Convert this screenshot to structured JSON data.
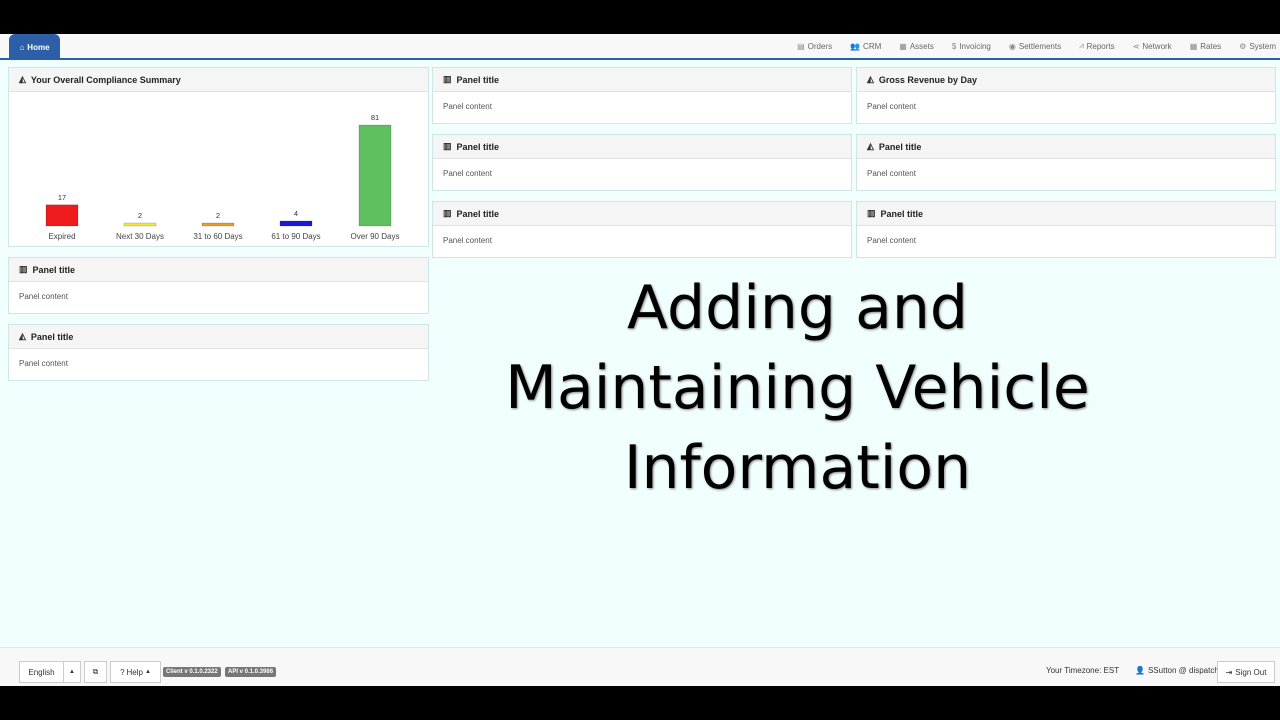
{
  "nav": {
    "home": "Home",
    "items": [
      {
        "label": "Orders",
        "icon": "document-icon",
        "glyph": "▤"
      },
      {
        "label": "CRM",
        "icon": "users-icon",
        "glyph": "👥"
      },
      {
        "label": "Assets",
        "icon": "truck-icon",
        "glyph": "▦"
      },
      {
        "label": "Invoicing",
        "icon": "dollar-icon",
        "glyph": "$"
      },
      {
        "label": "Settlements",
        "icon": "eye-icon",
        "glyph": "◉"
      },
      {
        "label": "Reports",
        "icon": "line-chart-icon",
        "glyph": "⩘"
      },
      {
        "label": "Network",
        "icon": "share-icon",
        "glyph": "⋖"
      },
      {
        "label": "Rates",
        "icon": "table-icon",
        "glyph": "▦"
      },
      {
        "label": "System",
        "icon": "gear-icon",
        "glyph": "⚙"
      }
    ]
  },
  "panels": {
    "compliance_title": "Your Overall Compliance Summary",
    "gross_revenue_title": "Gross Revenue by Day",
    "generic_title": "Panel title",
    "generic_content": "Panel content"
  },
  "chart_data": {
    "type": "bar",
    "categories": [
      "Expired",
      "Next 30 Days",
      "31 to 60 Days",
      "61 to 90 Days",
      "Over 90 Days"
    ],
    "values": [
      17,
      2,
      2,
      4,
      81
    ],
    "colors": [
      "#ee1c1c",
      "#f2e830",
      "#e8a020",
      "#1a1ad8",
      "#5ec05e"
    ],
    "title": "",
    "xlabel": "",
    "ylabel": ""
  },
  "headline": "Adding and Maintaining Vehicle Information",
  "footer": {
    "language": "English",
    "help": "Help",
    "client_version": "Client v 0.1.0.2322",
    "api_version": "API v 0.1.0.3986",
    "timezone": "Your Timezone: EST",
    "user": "SSutton @ dispatch",
    "sign_out": "Sign Out"
  }
}
